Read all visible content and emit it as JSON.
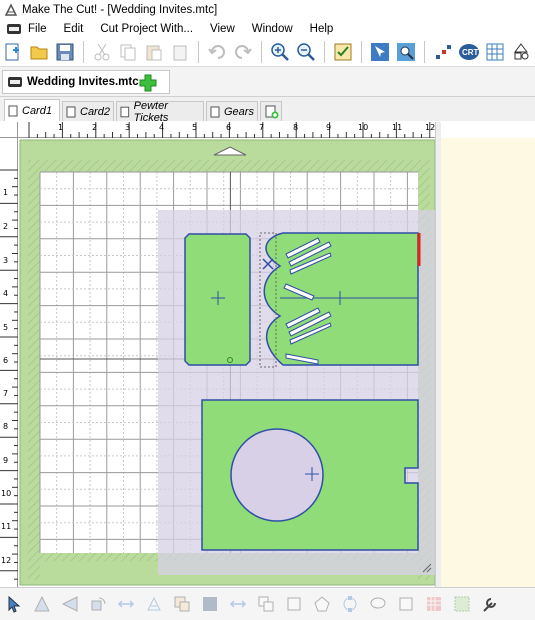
{
  "window": {
    "title": "Make The Cut! - [Wedding Invites.mtc]"
  },
  "menu": [
    "File",
    "Edit",
    "Cut Project With...",
    "View",
    "Window",
    "Help"
  ],
  "project": {
    "tab_label": "Wedding Invites.mtc"
  },
  "page_tabs": [
    "Card1",
    "Card2",
    "Pewter Tickets",
    "Gears"
  ],
  "ruler": {
    "horizontal": [
      "1",
      "2",
      "3",
      "4",
      "5",
      "6",
      "7",
      "8",
      "9",
      "10",
      "11",
      "12"
    ],
    "vertical": [
      "1",
      "2",
      "3",
      "4",
      "5",
      "6",
      "7",
      "8",
      "9",
      "10",
      "11",
      "12"
    ]
  },
  "colors": {
    "mat_green": "#b9dc9c",
    "shape_fill": "#8fdc78",
    "shape_stroke": "#2f4fa5",
    "selection": "#d7d0e6",
    "side_panel": "#fdf9e3"
  }
}
